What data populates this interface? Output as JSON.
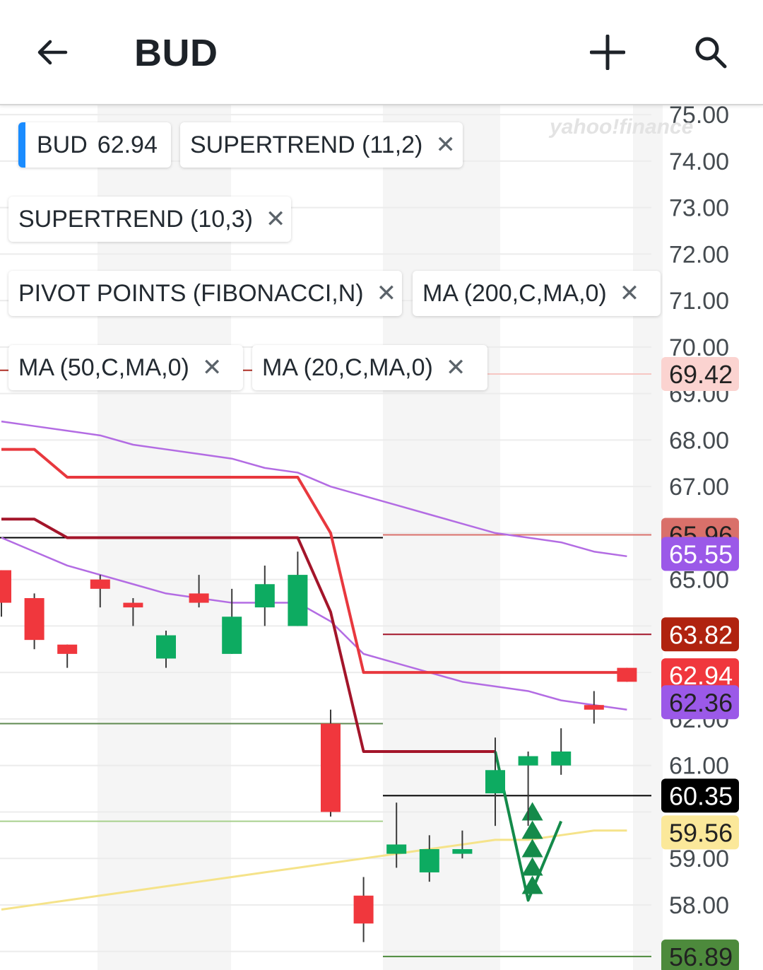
{
  "header": {
    "title": "BUD",
    "back_icon": "arrow-left-icon",
    "add_icon": "plus-icon",
    "search_icon": "search-icon"
  },
  "watermark": "yahoo!finance",
  "legend": {
    "symbol": "BUD",
    "price": "62.94",
    "indicators": [
      {
        "label": "SUPERTREND (11,2)"
      },
      {
        "label": "SUPERTREND (10,3)"
      },
      {
        "label": "PIVOT POINTS (FIBONACCI,N)"
      },
      {
        "label": "MA (200,C,MA,0)"
      },
      {
        "label": "MA (50,C,MA,0)"
      },
      {
        "label": "MA (20,C,MA,0)"
      }
    ],
    "close_glyph": "✕"
  },
  "colors": {
    "up": "#0dab61",
    "down": "#f0373d",
    "supertrend_fast": "#e8383e",
    "supertrend_slow": "#a3152a",
    "ma_purple": "#b36ce3",
    "ma_yellow": "#f5e38a",
    "pivot_black": "#000000"
  },
  "chart_data": {
    "type": "candlestick",
    "y_ticks": [
      "75.00",
      "74.00",
      "73.00",
      "72.00",
      "71.00",
      "70.00",
      "69.00",
      "68.00",
      "67.00",
      "66.00",
      "65.00",
      "62.00",
      "61.00",
      "59.00",
      "58.00"
    ],
    "ylim": [
      56.6,
      75.2
    ],
    "candles": [
      {
        "o": 65.2,
        "h": 65.2,
        "l": 64.2,
        "c": 64.5
      },
      {
        "o": 64.6,
        "h": 64.7,
        "l": 63.5,
        "c": 63.7
      },
      {
        "o": 63.6,
        "h": 63.6,
        "l": 63.1,
        "c": 63.4
      },
      {
        "o": 65.0,
        "h": 65.1,
        "l": 64.4,
        "c": 64.8
      },
      {
        "o": 64.5,
        "h": 64.6,
        "l": 64.0,
        "c": 64.4
      },
      {
        "o": 63.3,
        "h": 63.9,
        "l": 63.1,
        "c": 63.8
      },
      {
        "o": 64.7,
        "h": 65.1,
        "l": 64.4,
        "c": 64.5
      },
      {
        "o": 63.4,
        "h": 64.8,
        "l": 63.4,
        "c": 64.2
      },
      {
        "o": 64.4,
        "h": 65.3,
        "l": 64.0,
        "c": 64.9
      },
      {
        "o": 64.0,
        "h": 65.6,
        "l": 64.0,
        "c": 65.1
      },
      {
        "o": 61.9,
        "h": 62.2,
        "l": 59.9,
        "c": 60.0
      },
      {
        "o": 58.2,
        "h": 58.6,
        "l": 57.2,
        "c": 57.6
      },
      {
        "o": 59.1,
        "h": 60.2,
        "l": 58.8,
        "c": 59.3
      },
      {
        "o": 58.7,
        "h": 59.5,
        "l": 58.5,
        "c": 59.2
      },
      {
        "o": 59.1,
        "h": 59.6,
        "l": 59.0,
        "c": 59.2
      },
      {
        "o": 60.4,
        "h": 61.6,
        "l": 59.7,
        "c": 60.9
      },
      {
        "o": 61.0,
        "h": 61.3,
        "l": 59.7,
        "c": 61.2
      },
      {
        "o": 61.0,
        "h": 61.8,
        "l": 60.8,
        "c": 61.3
      },
      {
        "o": 62.3,
        "h": 62.6,
        "l": 61.9,
        "c": 62.2
      },
      {
        "o": 63.1,
        "h": 63.1,
        "l": 62.8,
        "c": 62.8
      }
    ],
    "supertrend_fast": [
      67.8,
      67.8,
      67.2,
      67.2,
      67.2,
      67.2,
      67.2,
      67.2,
      67.2,
      67.2,
      66.0,
      63.0,
      63.0,
      63.0,
      63.0,
      63.0,
      63.0,
      63.0,
      63.0,
      63.0
    ],
    "supertrend_slow": [
      66.3,
      66.3,
      65.9,
      65.9,
      65.9,
      65.9,
      65.9,
      65.9,
      65.9,
      65.9,
      64.3,
      61.3,
      61.3,
      61.3,
      61.3,
      61.3,
      58.1,
      59.8
    ],
    "ma_50": [
      68.4,
      68.3,
      68.2,
      68.1,
      67.9,
      67.8,
      67.7,
      67.6,
      67.4,
      67.3,
      67.0,
      66.8,
      66.6,
      66.4,
      66.2,
      66.0,
      65.9,
      65.8,
      65.6,
      65.5
    ],
    "ma_20": [
      65.9,
      65.6,
      65.3,
      65.1,
      64.9,
      64.7,
      64.6,
      64.5,
      64.5,
      64.5,
      64.1,
      63.4,
      63.2,
      63.0,
      62.8,
      62.7,
      62.6,
      62.4,
      62.3,
      62.2
    ],
    "ma_200": [
      57.9,
      58.0,
      58.1,
      58.2,
      58.3,
      58.4,
      58.5,
      58.6,
      58.7,
      58.8,
      58.9,
      59.0,
      59.1,
      59.2,
      59.3,
      59.4,
      59.4,
      59.5,
      59.6,
      59.6
    ],
    "pivot_lines": [
      {
        "value": 69.5,
        "color": "#b03127",
        "range": "left"
      },
      {
        "value": 65.9,
        "color": "#000000",
        "range": "left"
      },
      {
        "value": 61.9,
        "color": "#5f8a50",
        "range": "left"
      },
      {
        "value": 59.8,
        "color": "#a8d08d",
        "range": "left"
      },
      {
        "value": 65.96,
        "color": "#d9706a",
        "range": "right"
      },
      {
        "value": 63.82,
        "color": "#a3152a",
        "range": "right"
      },
      {
        "value": 60.35,
        "color": "#000000",
        "range": "right"
      },
      {
        "value": 56.89,
        "color": "#4d8a3c",
        "range": "right"
      },
      {
        "value": 69.42,
        "color": "#f6c6c3",
        "range": "right"
      }
    ],
    "price_tags": [
      {
        "value": 69.42,
        "label": "69.42",
        "bg": "#fbd3d0",
        "fg": "#222222"
      },
      {
        "value": 65.96,
        "label": "65.96",
        "bg": "#d9706a",
        "fg": "#222222"
      },
      {
        "value": 65.55,
        "label": "65.55",
        "bg": "#9b59e8",
        "fg": "#ffffff"
      },
      {
        "value": 63.82,
        "label": "63.82",
        "bg": "#b0230f",
        "fg": "#ffffff"
      },
      {
        "value": 62.94,
        "label": "62.94",
        "bg": "#f0373d",
        "fg": "#ffffff"
      },
      {
        "value": 62.36,
        "label": "62.36",
        "bg": "#9b59e8",
        "fg": "#222222"
      },
      {
        "value": 60.35,
        "label": "60.35",
        "bg": "#000000",
        "fg": "#ffffff"
      },
      {
        "value": 59.56,
        "label": "59.56",
        "bg": "#fbe89a",
        "fg": "#222222"
      },
      {
        "value": 56.89,
        "label": "56.89",
        "bg": "#4d8a3c",
        "fg": "#222222"
      }
    ],
    "buy_signals": 5
  }
}
